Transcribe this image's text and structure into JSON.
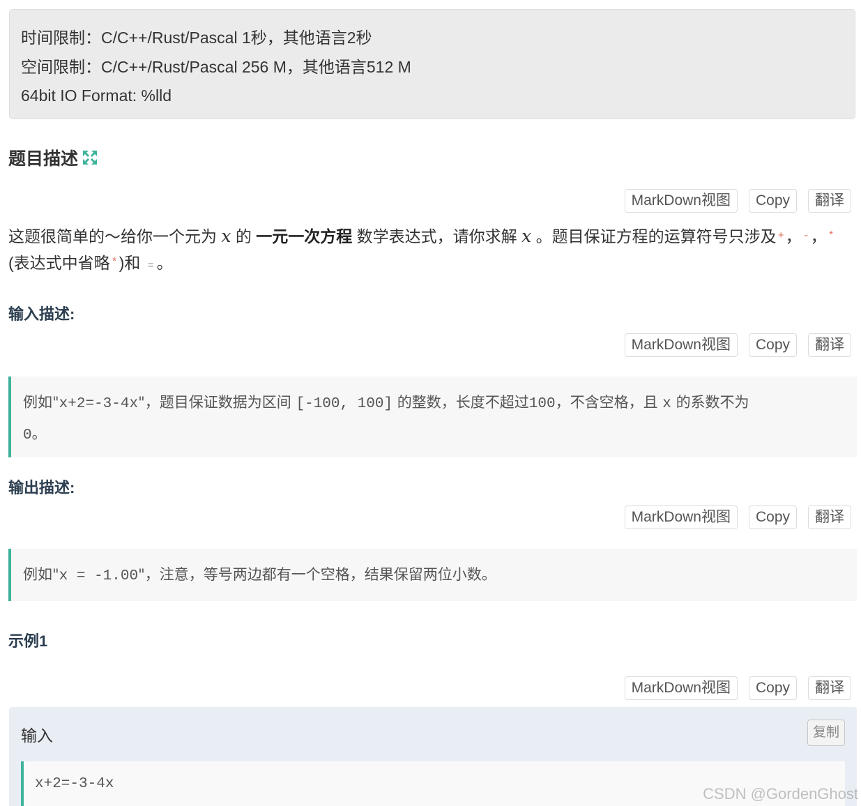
{
  "limits": {
    "time": "时间限制：C/C++/Rust/Pascal 1秒，其他语言2秒",
    "space": "空间限制：C/C++/Rust/Pascal 256 M，其他语言512 M",
    "io": "64bit IO Format: %lld"
  },
  "toolbar": {
    "markdown": "MarkDown视图",
    "copy": "Copy",
    "translate": "翻译"
  },
  "problem": {
    "title": "题目描述",
    "desc": {
      "p1": "这题很简单的～给你一个元为",
      "var": "x",
      "p2": "的",
      "bold": "一元一次方程",
      "p3": "数学表达式，请你求解",
      "p4": "。题目保证方程的运算符号只涉及",
      "plus": "+",
      "minus": "-",
      "star": "*",
      "p5": "(表达式中省略",
      "p6": ")和",
      "eq": "=",
      "p7": "。",
      "comma": "，"
    }
  },
  "input_section": {
    "title": "输入描述:",
    "q1": "例如\"",
    "code1": "x+2=-3-4x",
    "q2": "\"，题目保证数据为区间",
    "range": "[-100, 100]",
    "q3": "的整数，长度不超过",
    "len": "100",
    "q4": "，不含空格，且",
    "var": "x",
    "q5": "的系数不为",
    "zero": "0",
    "q6": "。"
  },
  "output_section": {
    "title": "输出描述:",
    "q1": "例如\"",
    "code": "x = -1.00",
    "q2": "\"，注意，等号两边都有一个空格，结果保留两位小数。"
  },
  "example": {
    "title": "示例1",
    "input_label": "输入",
    "copy_label": "复制",
    "input_value": "x+2=-3-4x"
  },
  "watermark": "CSDN @GordenGhost",
  "colors": {
    "accent": "#3fb39b",
    "operator": "#e06c5a"
  }
}
